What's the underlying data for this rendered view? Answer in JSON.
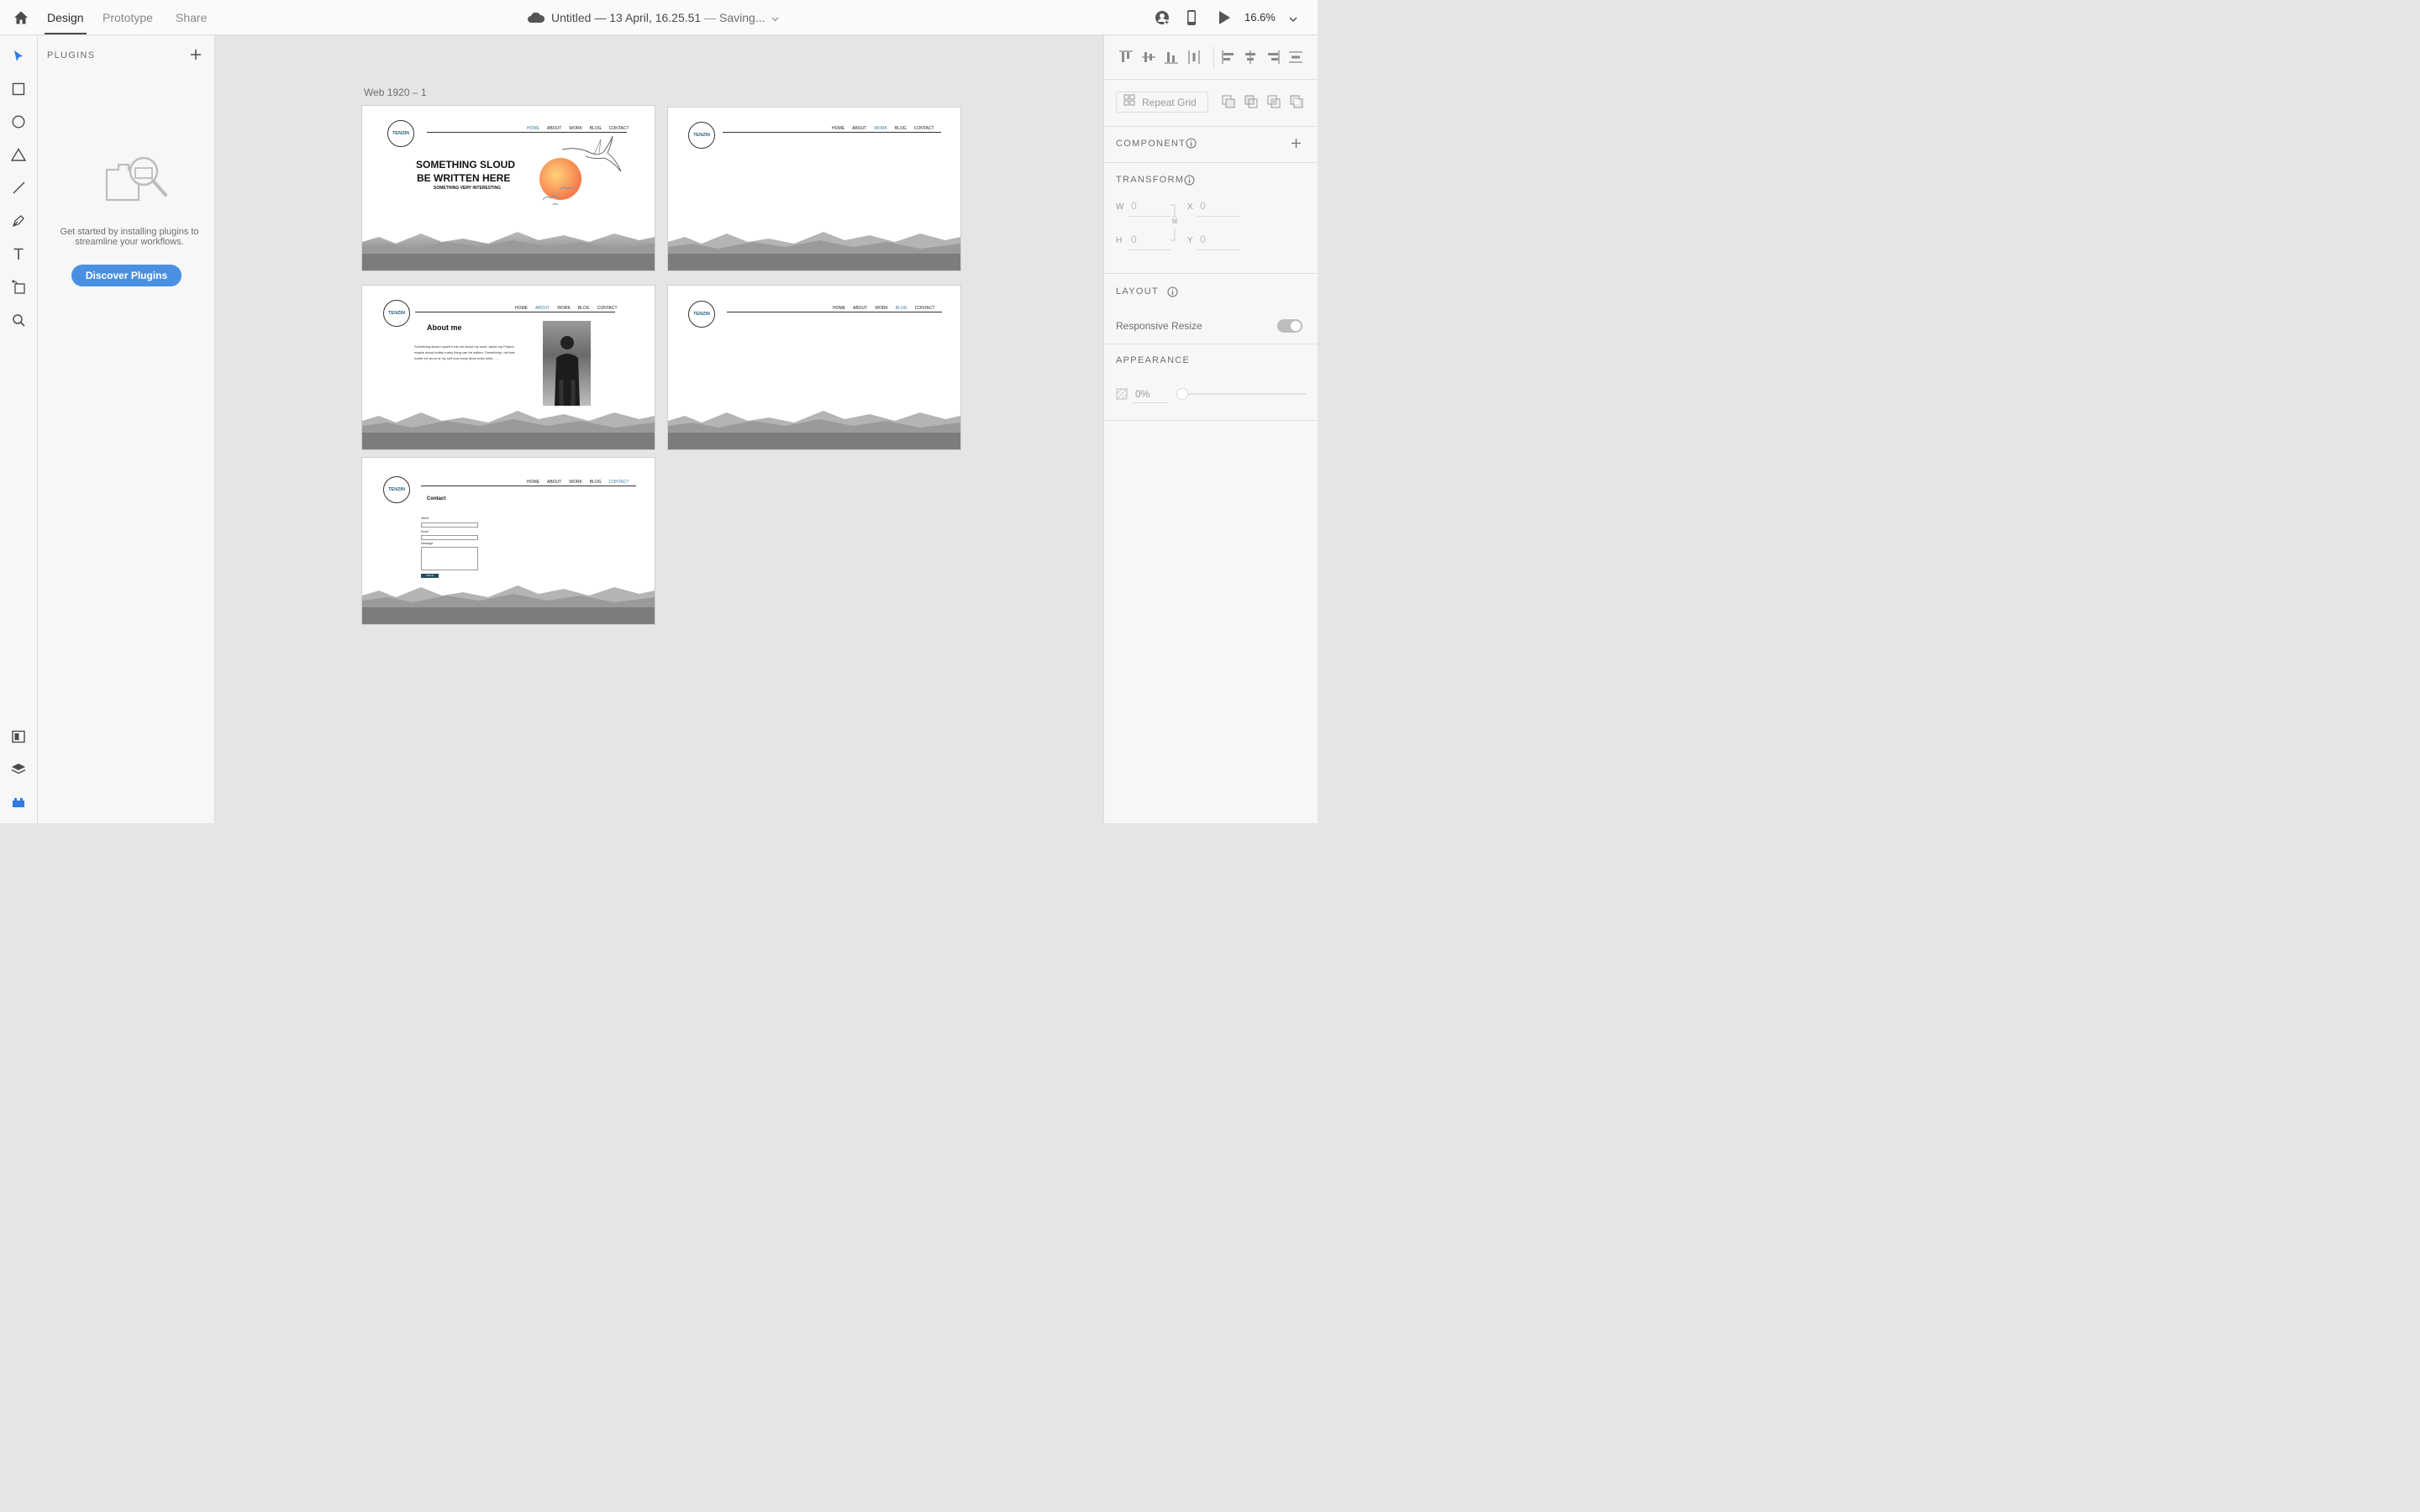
{
  "topbar": {
    "tabs": [
      "Design",
      "Prototype",
      "Share"
    ],
    "doc_title": "Untitled — 13 April, 16.25.51",
    "saving_status": "Saving...",
    "zoom": "16.6%"
  },
  "plugins": {
    "title": "PLUGINS",
    "empty_message": "Get started by installing plugins to streamline your workflows.",
    "discover_button": "Discover Plugins"
  },
  "props": {
    "repeat_grid": "Repeat Grid",
    "component_label": "COMPONENT",
    "transform_label": "TRANSFORM",
    "w_label": "W",
    "w_value": "0",
    "h_label": "H",
    "h_value": "0",
    "x_label": "X",
    "x_value": "0",
    "y_label": "Y",
    "y_value": "0",
    "layout_label": "LAYOUT",
    "responsive_resize": "Responsive Resize",
    "appearance_label": "APPEARANCE",
    "opacity_value": "0%"
  },
  "canvas": {
    "artboard_label": "Web 1920 – 1",
    "site": {
      "logo": "TENZIN",
      "nav": [
        "HOME",
        "ABOUT",
        "WORK",
        "BLOG",
        "CONTACT"
      ],
      "hero_line1": "SOMETHING SLOUD",
      "hero_line2": "BE WRITTEN HERE",
      "hero_sub": "SOMETHING VERY INTERESTING",
      "about_title": "About me",
      "about_body": "Something about myself it can be about my work, about my Project, maybe about hobby many thing can be written. Something I did that made me proof of my self and many More bolla bolla ......",
      "contact_title": "Contact",
      "contact_name": "Name",
      "contact_email": "Email",
      "contact_message": "Message",
      "contact_submit": "Submit"
    }
  },
  "colors": {
    "accent": "#4a90e2",
    "canvas_bg": "#e5e5e5",
    "panel_bg": "#f7f7f7",
    "teal": "#1f4d5a"
  }
}
